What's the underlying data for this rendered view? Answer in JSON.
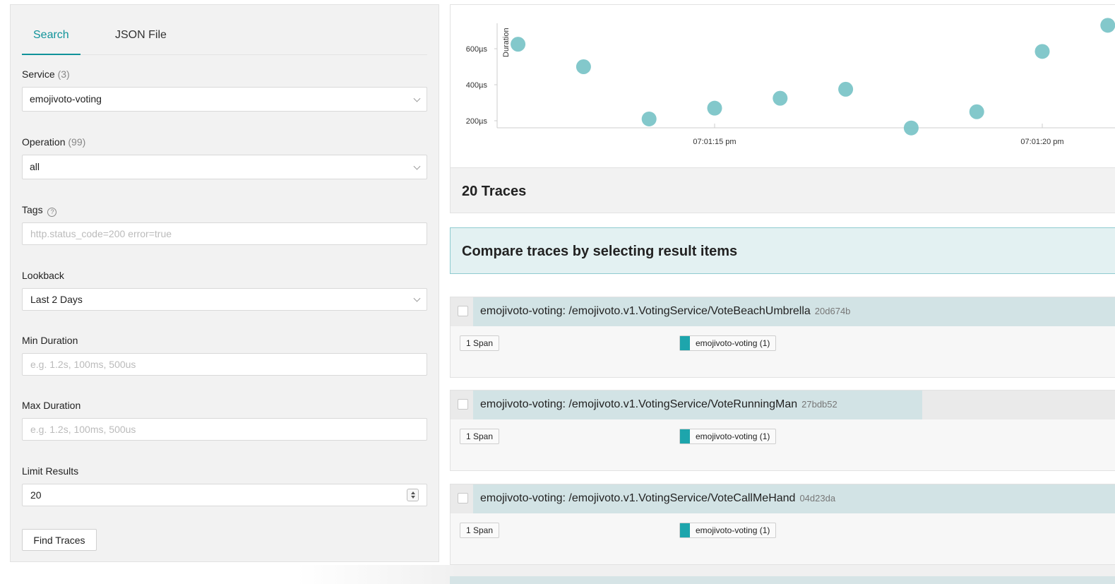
{
  "search": {
    "tabs": [
      {
        "label": "Search",
        "active": true
      },
      {
        "label": "JSON File",
        "active": false
      }
    ],
    "service": {
      "label": "Service",
      "count": "(3)",
      "value": "emojivoto-voting"
    },
    "operation": {
      "label": "Operation",
      "count": "(99)",
      "value": "all"
    },
    "tags": {
      "label": "Tags",
      "help_icon": "?",
      "placeholder": "http.status_code=200 error=true",
      "value": ""
    },
    "lookback": {
      "label": "Lookback",
      "value": "Last 2 Days"
    },
    "min_duration": {
      "label": "Min Duration",
      "placeholder": "e.g. 1.2s, 100ms, 500us",
      "value": ""
    },
    "max_duration": {
      "label": "Max Duration",
      "placeholder": "e.g. 1.2s, 100ms, 500us",
      "value": ""
    },
    "limit": {
      "label": "Limit Results",
      "value": "20"
    },
    "find_button": "Find Traces"
  },
  "chart_data": {
    "type": "scatter",
    "ylabel": "Duration",
    "xlabel": "",
    "yticks": [
      "200µs",
      "400µs",
      "600µs"
    ],
    "xticks": [
      "07:01:15 pm",
      "07:01:20 pm"
    ],
    "ylim": [
      130,
      600
    ],
    "xlim": [
      12,
      21
    ],
    "x_note": "seconds after 07:01:00 pm",
    "points": [
      {
        "x": 12.0,
        "y": 625
      },
      {
        "x": 13.0,
        "y": 500
      },
      {
        "x": 14.0,
        "y": 210
      },
      {
        "x": 15.0,
        "y": 270
      },
      {
        "x": 16.0,
        "y": 325
      },
      {
        "x": 17.0,
        "y": 375
      },
      {
        "x": 18.0,
        "y": 160
      },
      {
        "x": 19.0,
        "y": 250
      },
      {
        "x": 20.0,
        "y": 585
      },
      {
        "x": 21.0,
        "y": 730
      }
    ],
    "color": "#7cc5c8"
  },
  "results": {
    "count_label": "20 Traces",
    "compare_label": "Compare traces by selecting result items",
    "traces": [
      {
        "title": "emojivoto-voting: /emojivoto.v1.VotingService/VoteBeachUmbrella",
        "id": "20d674b",
        "spans": "1 Span",
        "service": "emojivoto-voting (1)",
        "bar_fraction": 1.0
      },
      {
        "title": "emojivoto-voting: /emojivoto.v1.VotingService/VoteRunningMan",
        "id": "27bdb52",
        "spans": "1 Span",
        "service": "emojivoto-voting (1)",
        "bar_fraction": 0.7
      },
      {
        "title": "emojivoto-voting: /emojivoto.v1.VotingService/VoteCallMeHand",
        "id": "04d23da",
        "spans": "1 Span",
        "service": "emojivoto-voting (1)",
        "bar_fraction": 1.0
      }
    ],
    "service_color": "#1da5ac"
  }
}
